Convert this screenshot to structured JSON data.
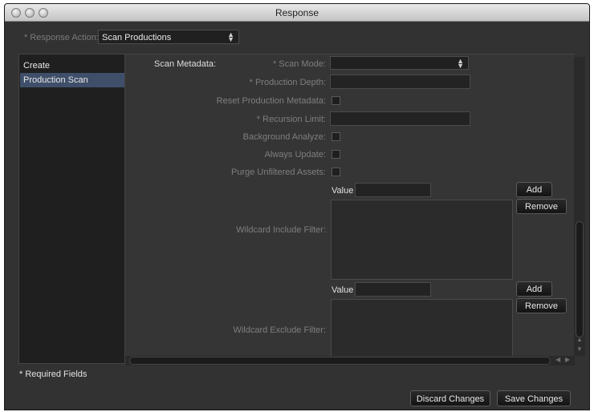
{
  "window": {
    "title": "Response"
  },
  "response_action": {
    "label": "* Response Action:",
    "value": "Scan Productions"
  },
  "left_list": {
    "items": [
      {
        "label": "Create"
      },
      {
        "label": "Production Scan"
      }
    ]
  },
  "form": {
    "section_label": "Scan Metadata:",
    "scan_mode_label": "* Scan Mode:",
    "production_depth_label": "* Production Depth:",
    "reset_production_metadata_label": "Reset Production Metadata:",
    "recursion_limit_label": "* Recursion Limit:",
    "background_analyze_label": "Background Analyze:",
    "always_update_label": "Always Update:",
    "purge_unfiltered_assets_label": "Purge Unfiltered Assets:",
    "include_value_label": "Value",
    "include_add_label": "Add",
    "include_remove_label": "Remove",
    "wildcard_include_label": "Wildcard Include Filter:",
    "exclude_value_label": "Value",
    "exclude_add_label": "Add",
    "exclude_remove_label": "Remove",
    "wildcard_exclude_label": "Wildcard Exclude Filter:"
  },
  "footer": {
    "required_note": "* Required Fields",
    "discard_label": "Discard Changes",
    "save_label": "Save Changes"
  },
  "icons": {
    "select_arrows": "up-down-arrows",
    "scroll_up": "triangle-up",
    "scroll_down": "triangle-down",
    "scroll_left": "triangle-left",
    "scroll_right": "triangle-right"
  }
}
